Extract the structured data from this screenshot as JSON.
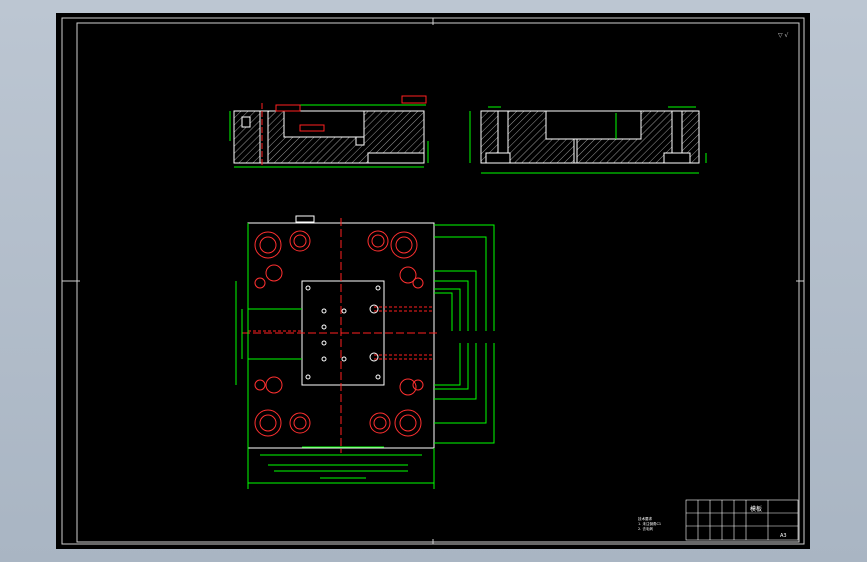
{
  "drawing": {
    "corner_mark": "▽ √",
    "front_view_label": "",
    "side_view_label": "",
    "title_block": {
      "name": "模板",
      "material": "",
      "scale": "",
      "sheet": "A3"
    },
    "notes": [
      "技术要求",
      "1. 未注倒角C1",
      "2. 去毛刺"
    ]
  },
  "colors": {
    "outline": "#ffffff",
    "dimension": "#00ff00",
    "center": "#ff2020",
    "hidden": "#ff4040",
    "background": "#000000",
    "frame": "#c8c8c8"
  }
}
